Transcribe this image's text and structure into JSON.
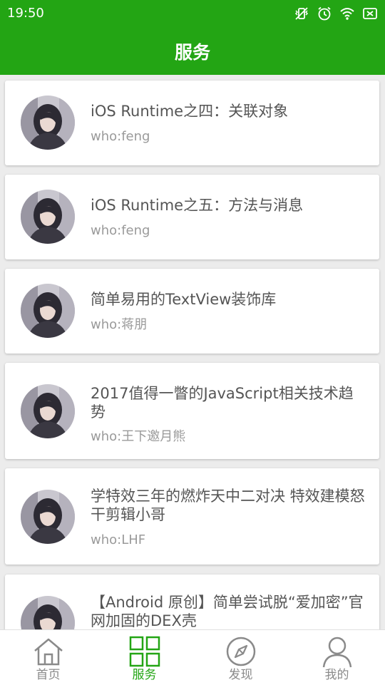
{
  "status_bar": {
    "time": "19:50"
  },
  "app_bar": {
    "title": "服务"
  },
  "colors": {
    "primary": "#23a514",
    "title_text": "#555555",
    "author_text": "#9a9a9a",
    "inactive_tab": "#8a8a8a"
  },
  "articles": [
    {
      "title": "iOS Runtime之四：关联对象",
      "author": "who:feng"
    },
    {
      "title": "iOS Runtime之五：方法与消息",
      "author": "who:feng"
    },
    {
      "title": "简单易用的TextView装饰库",
      "author": "who:蒋朋"
    },
    {
      "title": "2017值得一瞥的JavaScript相关技术趋势",
      "author": "who:王下邀月熊"
    },
    {
      "title": "学特效三年的燃炸天中二对决 特效建模怒干剪辑小哥",
      "author": "who:LHF"
    },
    {
      "title": "【Android 原创】简单尝试脱“爱加密”官网加固的DEX壳",
      "author": ""
    }
  ],
  "tabs": [
    {
      "label": "首页",
      "icon": "home-icon",
      "active": false
    },
    {
      "label": "服务",
      "icon": "grid-icon",
      "active": true
    },
    {
      "label": "发现",
      "icon": "compass-icon",
      "active": false
    },
    {
      "label": "我的",
      "icon": "person-icon",
      "active": false
    }
  ]
}
